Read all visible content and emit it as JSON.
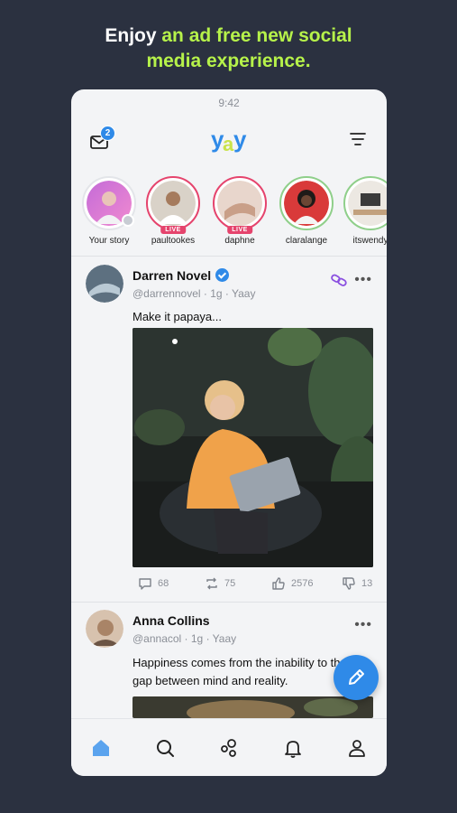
{
  "promo": {
    "line1_plain": "Enjoy ",
    "line1_accent": "an ad free new social",
    "line2_accent": "media experience."
  },
  "status_bar": {
    "time": "9:42"
  },
  "header": {
    "logo_text": "yay",
    "mail_badge": "2"
  },
  "stories": [
    {
      "name": "Your story",
      "live": false,
      "own": true
    },
    {
      "name": "paultookes",
      "live": true,
      "live_label": "LIVE"
    },
    {
      "name": "daphne",
      "live": true,
      "live_label": "LIVE"
    },
    {
      "name": "claralange",
      "live": false
    },
    {
      "name": "itswendy",
      "live": false
    }
  ],
  "posts": [
    {
      "author": "Darren Novel",
      "verified": true,
      "meta": "@darrennovel · 1g · Yaay",
      "text": "Make it papaya...",
      "comments": "68",
      "reposts": "75",
      "likes": "2576",
      "dislikes": "13"
    },
    {
      "author": "Anna Collins",
      "verified": false,
      "meta": "@annacol · 1g · Yaay",
      "text": "Happiness comes from the inability to the gap between mind and reality."
    }
  ],
  "icons": {
    "mail": "mail-icon",
    "filter": "filter-icon",
    "chain": "link-icon",
    "more": "more-horizontal-icon",
    "comment": "comment-icon",
    "repost": "repost-icon",
    "like": "thumbs-up-icon",
    "dislike": "thumbs-down-icon",
    "compose": "pen-icon",
    "home": "home-icon",
    "search": "search-icon",
    "discover": "bubbles-icon",
    "notifications": "bell-icon",
    "profile": "user-icon"
  },
  "colors": {
    "background": "#2b3140",
    "accent_green": "#b6f24a",
    "brand_blue": "#2f8ae8",
    "live_red": "#e5446d",
    "logo_yellow": "#c9e34a"
  }
}
